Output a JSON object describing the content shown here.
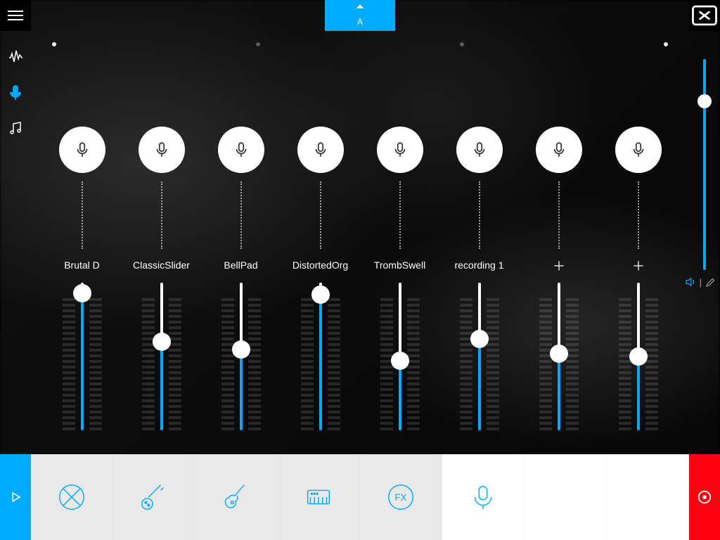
{
  "colors": {
    "accent": "#00aaff",
    "record": "#ff0010"
  },
  "top": {
    "tab_label": "A"
  },
  "sidebar": {
    "items": [
      {
        "name": "waveform-icon",
        "active": false
      },
      {
        "name": "mic-icon",
        "active": true
      },
      {
        "name": "notes-icon",
        "active": false
      }
    ]
  },
  "dots": [
    true,
    false,
    false,
    true
  ],
  "master": {
    "value": 0.8
  },
  "volume_indicator": {
    "text": ""
  },
  "tracks": [
    {
      "label": "Brutal D",
      "has_label": true,
      "fader": 0.93
    },
    {
      "label": "ClassicSlider",
      "has_label": true,
      "fader": 0.6
    },
    {
      "label": "BellPad",
      "has_label": true,
      "fader": 0.55
    },
    {
      "label": "DistortedOrg",
      "has_label": true,
      "fader": 0.92
    },
    {
      "label": "TrombSwell",
      "has_label": true,
      "fader": 0.47
    },
    {
      "label": "recording 1",
      "has_label": true,
      "fader": 0.62
    },
    {
      "label": "",
      "has_label": false,
      "fader": 0.52
    },
    {
      "label": "",
      "has_label": false,
      "fader": 0.5
    }
  ],
  "instruments": [
    {
      "name": "drum-icon",
      "selected": false,
      "empty": false
    },
    {
      "name": "bass-icon",
      "selected": false,
      "empty": false
    },
    {
      "name": "guitar-icon",
      "selected": false,
      "empty": false
    },
    {
      "name": "keys-icon",
      "selected": false,
      "empty": false
    },
    {
      "name": "fx-icon",
      "selected": false,
      "empty": false
    },
    {
      "name": "voice-icon",
      "selected": true,
      "empty": false
    },
    {
      "name": "empty-slot",
      "selected": false,
      "empty": true
    },
    {
      "name": "empty-slot",
      "selected": false,
      "empty": true
    }
  ]
}
